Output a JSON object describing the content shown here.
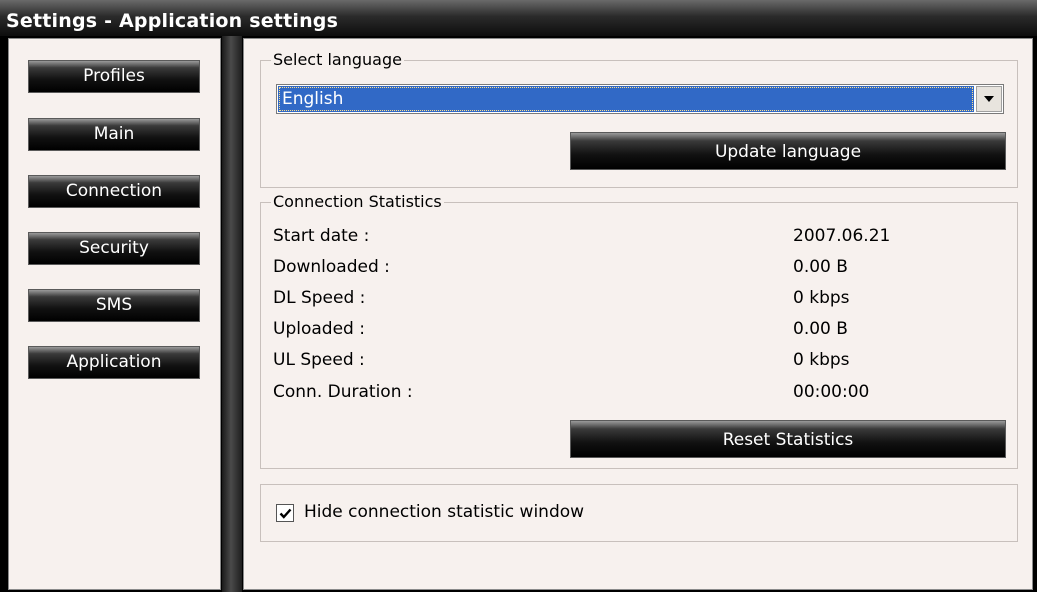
{
  "window": {
    "title": "Settings - Application settings"
  },
  "sidebar": {
    "items": [
      {
        "label": "Profiles"
      },
      {
        "label": "Main"
      },
      {
        "label": "Connection"
      },
      {
        "label": "Security"
      },
      {
        "label": "SMS"
      },
      {
        "label": "Application"
      }
    ]
  },
  "language": {
    "group_label": "Select language",
    "selected": "English",
    "update_label": "Update language"
  },
  "stats": {
    "group_label": "Connection Statistics",
    "rows": [
      {
        "label": "Start date :",
        "value": "2007.06.21"
      },
      {
        "label": "Downloaded :",
        "value": "0.00 B"
      },
      {
        "label": "DL Speed :",
        "value": "0 kbps"
      },
      {
        "label": "Uploaded :",
        "value": "0.00 B"
      },
      {
        "label": "UL Speed :",
        "value": "0 kbps"
      },
      {
        "label": "Conn. Duration :",
        "value": "00:00:00"
      }
    ],
    "reset_label": "Reset Statistics"
  },
  "options": {
    "hide_stats_label": "Hide connection statistic window",
    "hide_stats_checked": true
  }
}
